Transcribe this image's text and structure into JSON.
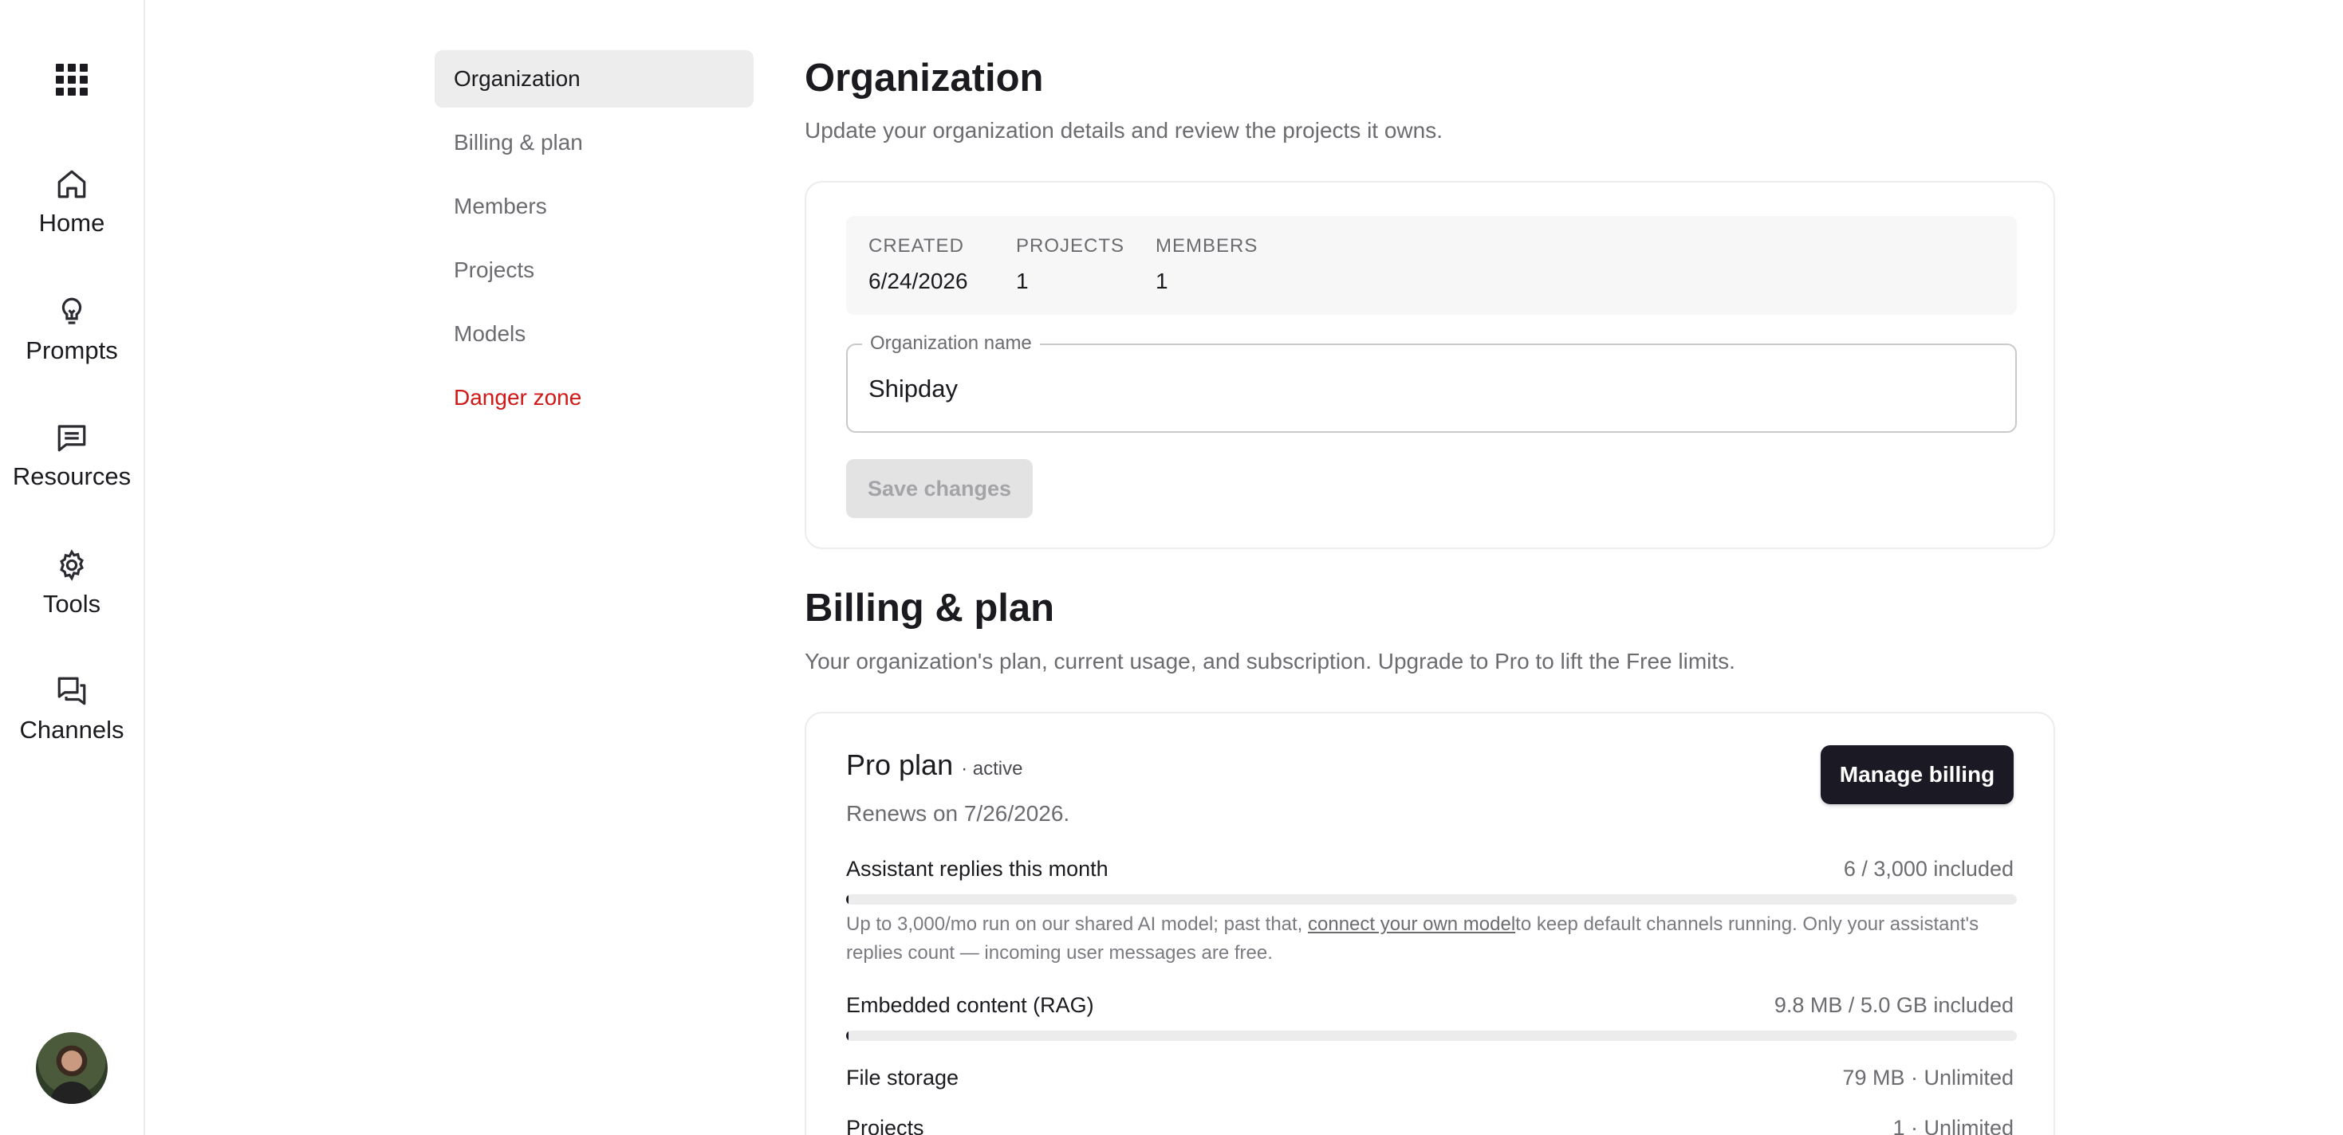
{
  "rail": {
    "items": [
      {
        "label": "Home",
        "icon": "home-icon"
      },
      {
        "label": "Prompts",
        "icon": "lightbulb-icon"
      },
      {
        "label": "Resources",
        "icon": "message-square-icon"
      },
      {
        "label": "Tools",
        "icon": "gear-icon"
      },
      {
        "label": "Channels",
        "icon": "chat-bubbles-icon"
      }
    ]
  },
  "section_nav": {
    "items": [
      {
        "label": "Organization"
      },
      {
        "label": "Billing & plan"
      },
      {
        "label": "Members"
      },
      {
        "label": "Projects"
      },
      {
        "label": "Models"
      },
      {
        "label": "Danger zone"
      }
    ],
    "active_index": 0
  },
  "organization": {
    "title": "Organization",
    "subtitle": "Update your organization details and review the projects it owns.",
    "stats": [
      {
        "label": "CREATED",
        "value": "6/24/2026"
      },
      {
        "label": "PROJECTS",
        "value": "1"
      },
      {
        "label": "MEMBERS",
        "value": "1"
      }
    ],
    "name_field": {
      "label": "Organization name",
      "value": "Shipday"
    },
    "save_label": "Save changes"
  },
  "billing": {
    "title": "Billing & plan",
    "subtitle": "Your organization's plan, current usage, and subscription. Upgrade to Pro to lift the Free limits.",
    "plan_name": "Pro plan",
    "plan_status": "· active",
    "renews": "Renews on 7/26/2026.",
    "manage_label": "Manage billing",
    "usage": [
      {
        "label": "Assistant replies this month",
        "value": "6 / 3,000 included",
        "fraction": 0.002
      },
      {
        "label": "Embedded content (RAG)",
        "value": "9.8 MB / 5.0 GB included",
        "fraction": 0.002
      },
      {
        "label": "File storage",
        "value": "79 MB · Unlimited"
      },
      {
        "label": "Projects",
        "value": "1 · Unlimited"
      }
    ],
    "note": {
      "before": "Up to 3,000/mo run on our shared AI model; past that, ",
      "link": "connect your own model",
      "after": "to keep default channels running. Only your assistant's replies count — incoming user messages are free."
    }
  },
  "colors": {
    "accent_dark": "#1b1a24",
    "danger": "#d01818",
    "muted": "#6b6b70"
  }
}
